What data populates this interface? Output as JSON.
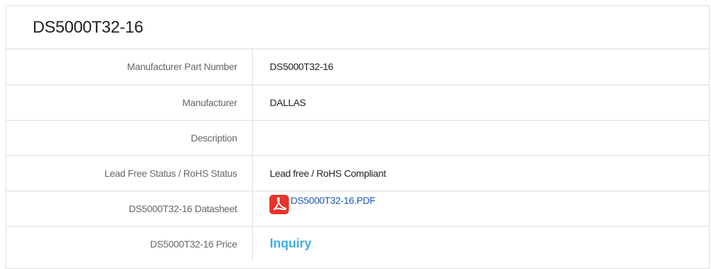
{
  "product": {
    "title": "DS5000T32-16"
  },
  "specs": {
    "rows": [
      {
        "label": "Manufacturer Part Number",
        "value": "DS5000T32-16"
      },
      {
        "label": "Manufacturer",
        "value": "DALLAS"
      },
      {
        "label": "Description",
        "value": ""
      },
      {
        "label": "Lead Free Status / RoHS Status",
        "value": "Lead free / RoHS Compliant"
      },
      {
        "label": "DS5000T32-16 Datasheet",
        "link_text": "DS5000T32-16.PDF",
        "icon": "pdf-icon"
      },
      {
        "label": "DS5000T32-16 Price",
        "link_text": "Inquiry"
      }
    ]
  },
  "colors": {
    "pdf_icon": "#e8322b",
    "link": "#1a56b8",
    "inquiry": "#3aaee0",
    "border": "#dddddd"
  }
}
